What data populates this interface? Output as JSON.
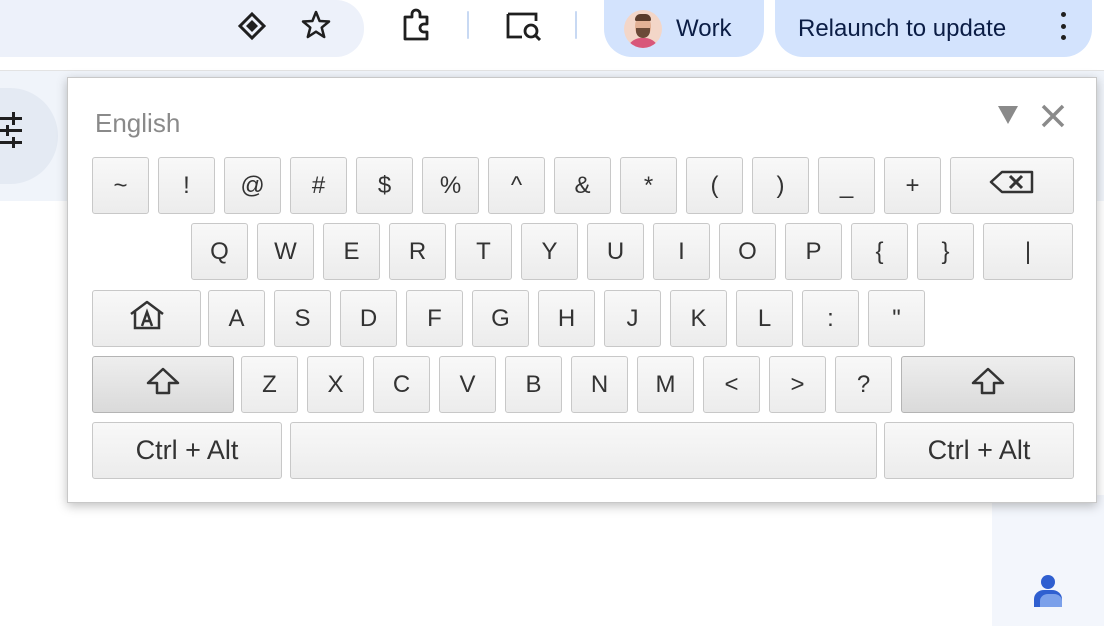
{
  "toolbar": {
    "profile": {
      "label": "Work"
    },
    "relaunch": {
      "label": "Relaunch to update"
    }
  },
  "keyboard": {
    "language": "English",
    "rows": [
      [
        "~",
        "!",
        "@",
        "#",
        "$",
        "%",
        "^",
        "&",
        "*",
        "(",
        ")",
        "_",
        "+"
      ],
      [
        "Q",
        "W",
        "E",
        "R",
        "T",
        "Y",
        "U",
        "I",
        "O",
        "P",
        "{",
        "}",
        "|"
      ],
      [
        "A",
        "S",
        "D",
        "F",
        "G",
        "H",
        "J",
        "K",
        "L",
        ":",
        "\""
      ],
      [
        "Z",
        "X",
        "C",
        "V",
        "B",
        "N",
        "M",
        "<",
        ">",
        "?"
      ]
    ],
    "ctrl_alt_label": "Ctrl + Alt",
    "icons": {
      "backspace": "backspace-icon",
      "home": "home-icon",
      "shift": "shift-icon",
      "menu": "triangle-down-icon",
      "close": "close-icon"
    }
  }
}
